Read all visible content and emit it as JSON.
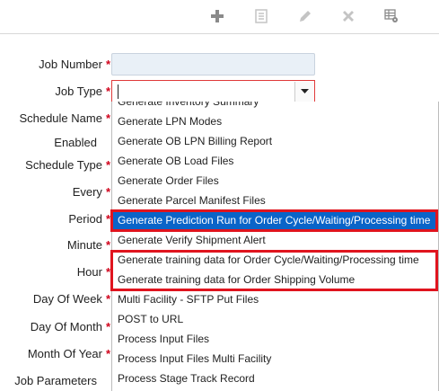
{
  "toolbar": {
    "icons": [
      "plus-icon",
      "document-icon",
      "pencil-icon",
      "close-icon",
      "grid-settings-icon"
    ]
  },
  "form": {
    "job_number_label": "Job Number",
    "job_type_label": "Job Type",
    "schedule_name_label": "Schedule Name",
    "enabled_label": "Enabled",
    "schedule_type_label": "Schedule Type",
    "every_label": "Every",
    "period_label": "Period",
    "minute_label": "Minute",
    "hour_label": "Hour",
    "day_of_week_label": "Day Of Week",
    "day_of_month_label": "Day Of Month",
    "month_of_year_label": "Month Of Year",
    "job_parameters_label": "Job Parameters",
    "required_marker": "*",
    "job_number_value": "",
    "job_type_value": ""
  },
  "dropdown": {
    "options": [
      "Generate Inventory Summary",
      "Generate LPN Modes",
      "Generate OB LPN Billing Report",
      "Generate OB Load Files",
      "Generate Order Files",
      "Generate Parcel Manifest Files",
      "Generate Prediction Run for Order Cycle/Waiting/Processing time",
      "Generate Verify Shipment Alert",
      "Generate training data for Order Cycle/Waiting/Processing time",
      "Generate training data for Order Shipping Volume",
      "Multi Facility - SFTP Put Files",
      "POST to URL",
      "Process Input Files",
      "Process Input Files Multi Facility",
      "Process Stage Track Record"
    ],
    "selected_option": "Generate Prediction Run for Order Cycle/Waiting/Processing time"
  },
  "colors": {
    "selected_bg": "#0a64c8",
    "highlight_border": "#e0141e",
    "required": "#d0021b"
  }
}
